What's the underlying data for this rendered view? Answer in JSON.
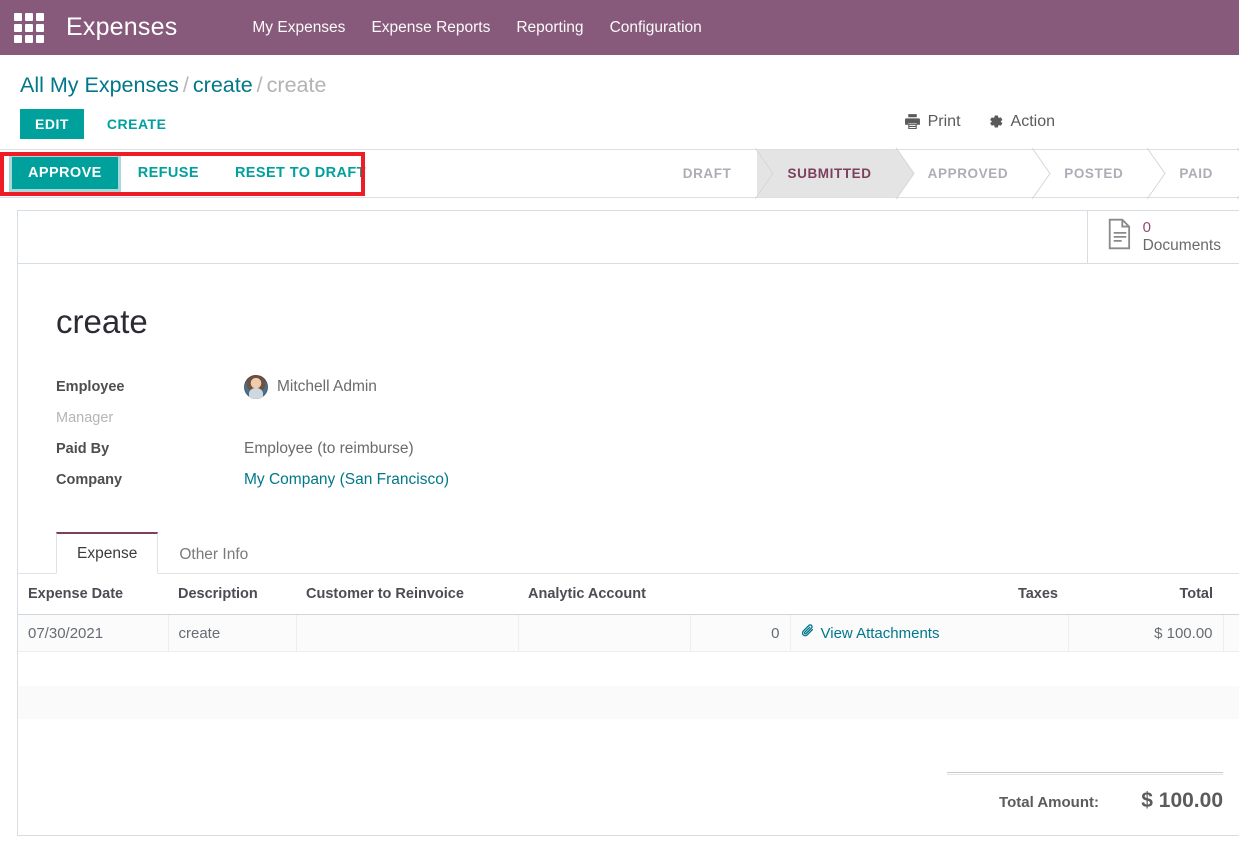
{
  "navbar": {
    "apps_icon": "apps-grid-icon",
    "brand": "Expenses",
    "menu": [
      {
        "label": "My Expenses"
      },
      {
        "label": "Expense Reports"
      },
      {
        "label": "Reporting"
      },
      {
        "label": "Configuration"
      }
    ]
  },
  "control_panel": {
    "breadcrumb": {
      "root": "All My Expenses",
      "sep1": "/",
      "parent": "create",
      "sep2": "/",
      "current": "create"
    },
    "edit_label": "EDIT",
    "create_label": "CREATE",
    "print_label": "Print",
    "action_label": "Action",
    "print_icon": "printer-icon",
    "action_icon": "gear-icon"
  },
  "statusbar": {
    "buttons": [
      {
        "label": "APPROVE",
        "style": "primary"
      },
      {
        "label": "REFUSE",
        "style": "secondary"
      },
      {
        "label": "RESET TO DRAFT",
        "style": "secondary"
      }
    ],
    "stages": [
      {
        "label": "DRAFT",
        "active": false
      },
      {
        "label": "SUBMITTED",
        "active": true
      },
      {
        "label": "APPROVED",
        "active": false
      },
      {
        "label": "POSTED",
        "active": false
      },
      {
        "label": "PAID",
        "active": false
      }
    ]
  },
  "annotation": {
    "color": "#ee1c25",
    "target": "workflow-buttons"
  },
  "button_box": {
    "documents": {
      "icon": "document-icon",
      "count": "0",
      "label": "Documents"
    }
  },
  "form": {
    "title": "create",
    "fields": [
      {
        "label": "Employee",
        "value": "Mitchell Admin",
        "kind": "avatar",
        "muted_label": false
      },
      {
        "label": "Manager",
        "value": "",
        "kind": "text",
        "muted_label": true
      },
      {
        "label": "Paid By",
        "value": "Employee (to reimburse)",
        "kind": "text",
        "muted_label": false
      },
      {
        "label": "Company",
        "value": "My Company (San Francisco)",
        "kind": "link",
        "muted_label": false
      }
    ]
  },
  "notebook": {
    "tabs": [
      {
        "label": "Expense",
        "active": true
      },
      {
        "label": "Other Info",
        "active": false
      }
    ]
  },
  "lines": {
    "columns": [
      {
        "label": "Expense Date",
        "align": "left"
      },
      {
        "label": "Description",
        "align": "left"
      },
      {
        "label": "Customer to Reinvoice",
        "align": "left"
      },
      {
        "label": "Analytic Account",
        "align": "left"
      },
      {
        "label": "",
        "align": "right"
      },
      {
        "label": "Taxes",
        "align": "right"
      },
      {
        "label": "Total",
        "align": "right"
      }
    ],
    "options_icon": "vertical-dots-icon",
    "rows": [
      {
        "expense_date": "07/30/2021",
        "description": "create",
        "customer_to_reinvoice": "",
        "analytic_account": "",
        "attachment_count": "0",
        "attachment_link": "View Attachments",
        "attachment_icon": "paperclip-icon",
        "taxes": "",
        "total": "$ 100.00"
      }
    ],
    "empty_row_count": 3
  },
  "totals": {
    "label": "Total Amount:",
    "value": "$ 100.00"
  },
  "colors": {
    "brand_purple": "#875A7B",
    "accent_teal": "#00A09D",
    "link_teal": "#00788a",
    "annotation_red": "#ee1c25",
    "stage_active_text": "#7d3f5e"
  }
}
